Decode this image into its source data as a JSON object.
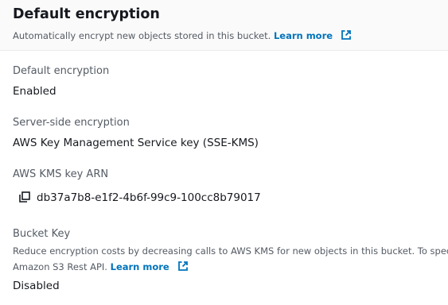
{
  "header": {
    "title": "Default encryption",
    "description": "Automatically encrypt new objects stored in this bucket.",
    "learn_more": "Learn more"
  },
  "fields": {
    "default_encryption": {
      "label": "Default encryption",
      "value": "Enabled"
    },
    "server_side_encryption": {
      "label": "Server-side encryption",
      "value": "AWS Key Management Service key (SSE-KMS)"
    },
    "kms_key_arn": {
      "label": "AWS KMS key ARN",
      "value": "db37a7b8-e1f2-4b6f-99c9-100cc8b79017"
    },
    "bucket_key": {
      "label": "Bucket Key",
      "description_line1": "Reduce encryption costs by decreasing calls to AWS KMS for new objects in this bucket. To specify a B",
      "description_line2": "Amazon S3 Rest API.",
      "learn_more": "Learn more",
      "value": "Disabled"
    }
  },
  "colors": {
    "link": "#0073bb",
    "label": "#545b64",
    "text": "#16191f",
    "header_bg": "#fafafa"
  },
  "icons": {
    "external_link": "external-link-icon",
    "copy": "copy-icon"
  }
}
